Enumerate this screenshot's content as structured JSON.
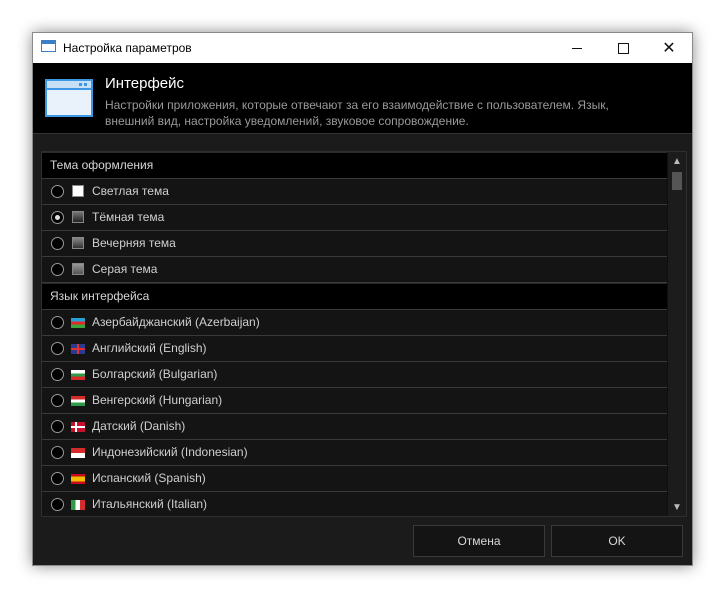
{
  "window": {
    "title": "Настройка параметров"
  },
  "header": {
    "title": "Интерфейс",
    "description": "Настройки приложения, которые отвечают за его взаимодействие с пользователем. Язык, внешний вид, настройка уведомлений, звуковое сопровождение."
  },
  "sections": {
    "theme": {
      "title": "Тема оформления",
      "items": [
        {
          "label": "Светлая тема",
          "icon": "light-theme-swatch",
          "selected": false
        },
        {
          "label": "Тёмная тема",
          "icon": "dark-theme-swatch",
          "selected": true
        },
        {
          "label": "Вечерняя тема",
          "icon": "evening-theme-swatch",
          "selected": false
        },
        {
          "label": "Серая тема",
          "icon": "gray-theme-swatch",
          "selected": false
        }
      ]
    },
    "language": {
      "title": "Язык интерфейса",
      "items": [
        {
          "label": "Азербайджанский (Azerbaijan)",
          "icon": "azerbaijan-flag-icon",
          "selected": false
        },
        {
          "label": "Английский (English)",
          "icon": "uk-flag-icon",
          "selected": false
        },
        {
          "label": "Болгарский (Bulgarian)",
          "icon": "bulgaria-flag-icon",
          "selected": false
        },
        {
          "label": "Венгерский (Hungarian)",
          "icon": "hungary-flag-icon",
          "selected": false
        },
        {
          "label": "Датский (Danish)",
          "icon": "denmark-flag-icon",
          "selected": false
        },
        {
          "label": "Индонезийский (Indonesian)",
          "icon": "indonesia-flag-icon",
          "selected": false
        },
        {
          "label": "Испанский (Spanish)",
          "icon": "spain-flag-icon",
          "selected": false
        },
        {
          "label": "Итальянский (Italian)",
          "icon": "italy-flag-icon",
          "selected": false
        }
      ]
    }
  },
  "buttons": {
    "cancel": "Отмена",
    "ok": "OK"
  },
  "colors": {
    "background": "#1b1b1b",
    "header": "#000000",
    "text": "#cfcfcf",
    "accent": "#3d97e4"
  }
}
